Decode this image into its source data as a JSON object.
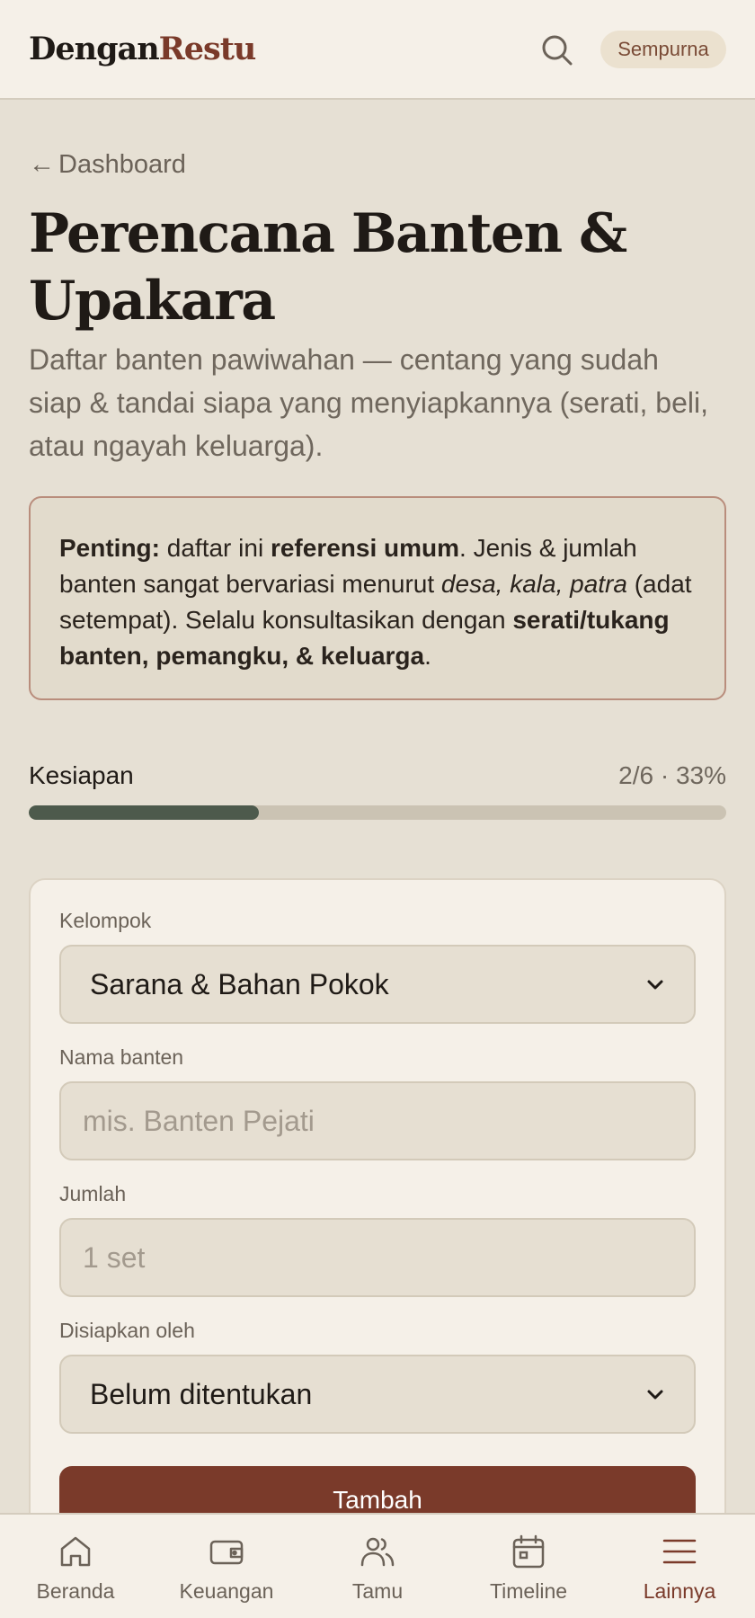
{
  "header": {
    "logo_part1": "Dengan",
    "logo_part2": "Restu",
    "search_icon": "search-icon",
    "badge": "Sempurna"
  },
  "page": {
    "back_label": "Dashboard",
    "title": "Perencana Banten & Upakara",
    "subtitle": "Daftar banten pawiwahan — centang yang sudah siap & tandai siapa yang menyiapkannya (serati, beli, atau ngayah keluarga)."
  },
  "notice": {
    "strong_1": "Penting:",
    "text_1": " daftar ini ",
    "strong_2": "referensi umum",
    "text_2": ". Jenis & jumlah banten sangat bervariasi menurut ",
    "italic": "desa, kala, patra",
    "text_3": " (adat setempat). Selalu konsultasikan dengan ",
    "strong_3": "serati/tukang banten, pemangku, & keluarga",
    "text_4": "."
  },
  "progress": {
    "label": "Kesiapan",
    "count": "2/6 · 33%",
    "fraction": 0.33
  },
  "form": {
    "group_label": "Kelompok",
    "group_value": "Sarana & Bahan Pokok",
    "name_label": "Nama banten",
    "name_placeholder": "mis. Banten Pejati",
    "qty_label": "Jumlah",
    "qty_placeholder": "1 set",
    "prepared_label": "Disiapkan oleh",
    "prepared_value": "Belum ditentukan",
    "add_button": "Tambah"
  },
  "nav": {
    "items": [
      {
        "label": "Beranda",
        "icon": "home-icon"
      },
      {
        "label": "Keuangan",
        "icon": "wallet-icon"
      },
      {
        "label": "Tamu",
        "icon": "users-icon"
      },
      {
        "label": "Timeline",
        "icon": "calendar-icon"
      },
      {
        "label": "Lainnya",
        "icon": "menu-icon",
        "active": true
      }
    ]
  },
  "colors": {
    "accent": "#7a3a2a",
    "progress": "#4d5a4c",
    "background": "#e6e0d4",
    "surface": "#f5f0e8"
  }
}
